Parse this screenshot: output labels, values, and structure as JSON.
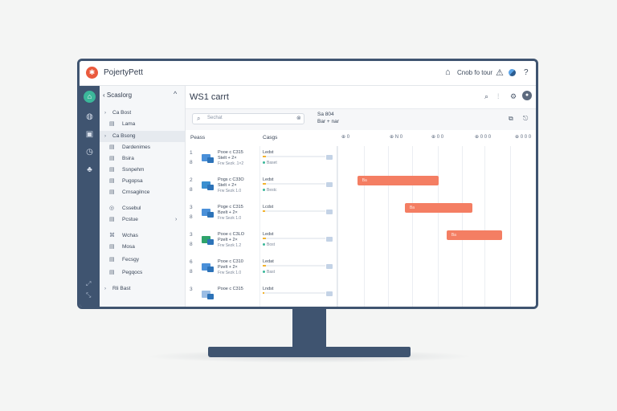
{
  "app": {
    "brand": "PojertyPett",
    "contact_label": "Cnob fo tour"
  },
  "icons": {
    "logo": "flame-icon",
    "bell": "bell-icon",
    "warning": "warning-icon",
    "help": "help-icon"
  },
  "colors": {
    "accent": "#3bb79a",
    "rail": "#3f5470",
    "gantt_bar": "#f47e63",
    "logo": "#ea5a3d"
  },
  "nav": {
    "header": "Scaslorg",
    "items": [
      {
        "label": "Ca Bost",
        "icon": "#",
        "arrow": "›"
      },
      {
        "label": "Lama",
        "icon": "▤"
      },
      {
        "label": "Ca Bsong",
        "icon": "≡",
        "arrow": "›",
        "selected": true
      },
      {
        "label": "Dardenimes",
        "icon": "▤"
      },
      {
        "label": "Bsira",
        "icon": "▤"
      },
      {
        "label": "Ssnpehm",
        "icon": "▤"
      },
      {
        "label": "Pugopsa",
        "icon": "▤"
      },
      {
        "label": "Crnsagilnce",
        "icon": "▤"
      },
      {
        "label": "Cssebul",
        "icon": "◎"
      },
      {
        "label": "Pcstue",
        "icon": "▤",
        "expander": "›"
      },
      {
        "label": "Wchas",
        "icon": "⌘"
      },
      {
        "label": "Mosa",
        "icon": "▤"
      },
      {
        "label": "Fecsgy",
        "icon": "▤"
      },
      {
        "label": "Pegqocs",
        "icon": "▤"
      },
      {
        "label": "Rli Bast",
        "icon": "≡",
        "arrow": "›"
      }
    ]
  },
  "main": {
    "title": "WS1 carrt",
    "search_placeholder": "Sechat",
    "selection": {
      "line1": "Sa 804",
      "line2": "Bar + nar"
    },
    "columns": {
      "name": "Peass",
      "status": "Casgs"
    },
    "timeline_headers": [
      "0",
      "N 0",
      "0 0",
      "0 0 0",
      "0 0 0"
    ]
  },
  "rows": [
    {
      "num": "1",
      "num2": "8",
      "thumb": "#4a90d9",
      "t1": "Pooe c C315",
      "t2": "Stelt + 2×",
      "t3": "Frw Sezk  .1×2",
      "status": "Ledst",
      "progress": 0.05,
      "state": "Baset"
    },
    {
      "num": "2",
      "num2": "8",
      "thumb": "#3a8fd0",
      "t1": "Pogs c C33O",
      "t2": "Stelt + 2×",
      "t3": "Frw Sezk  1.0",
      "status": "Ledst",
      "progress": 0.05,
      "state": "Bestc"
    },
    {
      "num": "3",
      "num2": "8",
      "thumb": "#4a90d9",
      "t1": "Poge c C315",
      "t2": "Bzelt + 2×",
      "t3": "Frw Sezk  1.0",
      "status": "Lcdst",
      "progress": 0.04,
      "state": ""
    },
    {
      "num": "3",
      "num2": "8",
      "thumb": "#2fa36b",
      "t1": "Pooe c C3LO",
      "t2": "Pzelt + 2×",
      "t3": "Frw Sezk  1.2",
      "status": "Ledst",
      "progress": 0.05,
      "state": "Bost"
    },
    {
      "num": "6",
      "num2": "8",
      "thumb": "#4a90d9",
      "t1": "Pooe c C310",
      "t2": "Pzelt + 2×",
      "t3": "Frw Sezk  1.0",
      "status": "Ledat",
      "progress": 0.05,
      "state": "Bast"
    },
    {
      "num": "3",
      "num2": "",
      "thumb": "#9bbde4",
      "t1": "Pooe c C315",
      "t2": "",
      "t3": "",
      "status": "Lndst",
      "progress": 0.0,
      "state": ""
    }
  ],
  "gantt": [
    {
      "label": "Ba",
      "row": 1,
      "start": 0.1,
      "end": 0.51
    },
    {
      "label": "Ba",
      "row": 2,
      "start": 0.34,
      "end": 0.68
    },
    {
      "label": "Ba",
      "row": 3,
      "start": 0.55,
      "end": 0.83
    }
  ]
}
